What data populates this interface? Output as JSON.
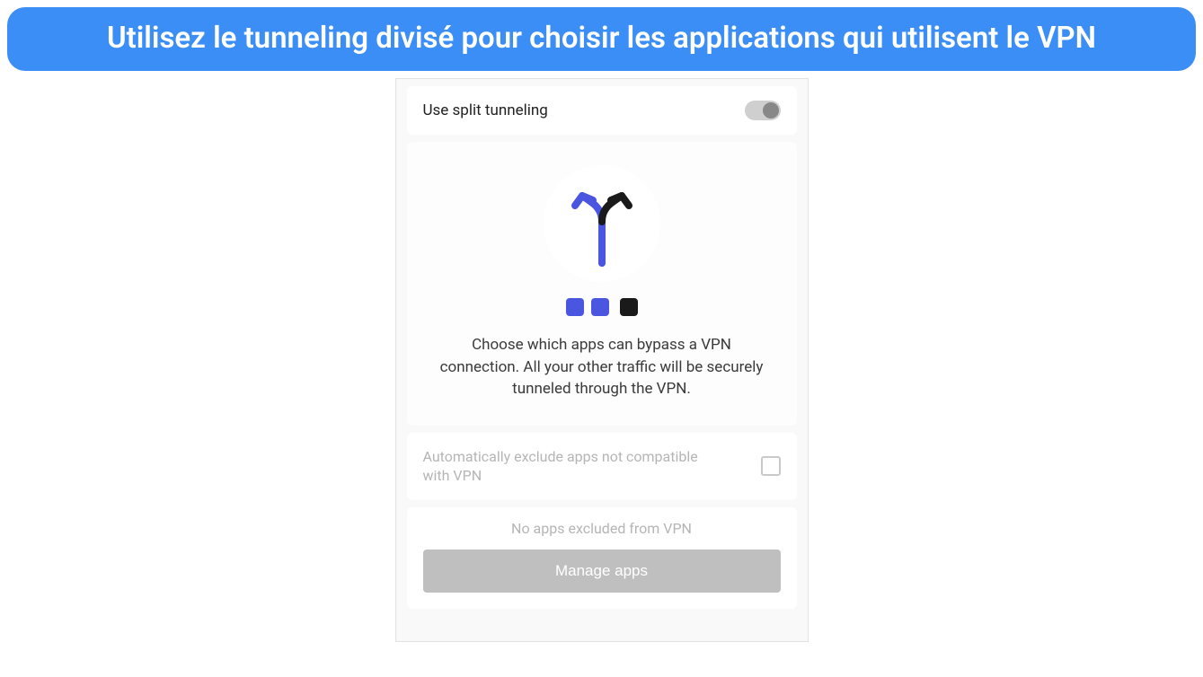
{
  "banner": {
    "title": "Utilisez le tunneling divisé pour choisir les applications qui utilisent le VPN"
  },
  "settings": {
    "split_tunneling_label": "Use split tunneling",
    "split_tunneling_enabled": false,
    "info_text": "Choose which apps can bypass a VPN connection. All your other traffic will be securely tunneled through the VPN.",
    "auto_exclude_label": "Automatically exclude apps not compatible with VPN",
    "auto_exclude_checked": false,
    "no_apps_text": "No apps excluded from VPN",
    "manage_button_label": "Manage apps"
  },
  "colors": {
    "banner_bg": "#3b8ef5",
    "accent_blue": "#4a55e0",
    "icon_black": "#1a1a1a",
    "disabled_gray": "#bfbfbf"
  }
}
